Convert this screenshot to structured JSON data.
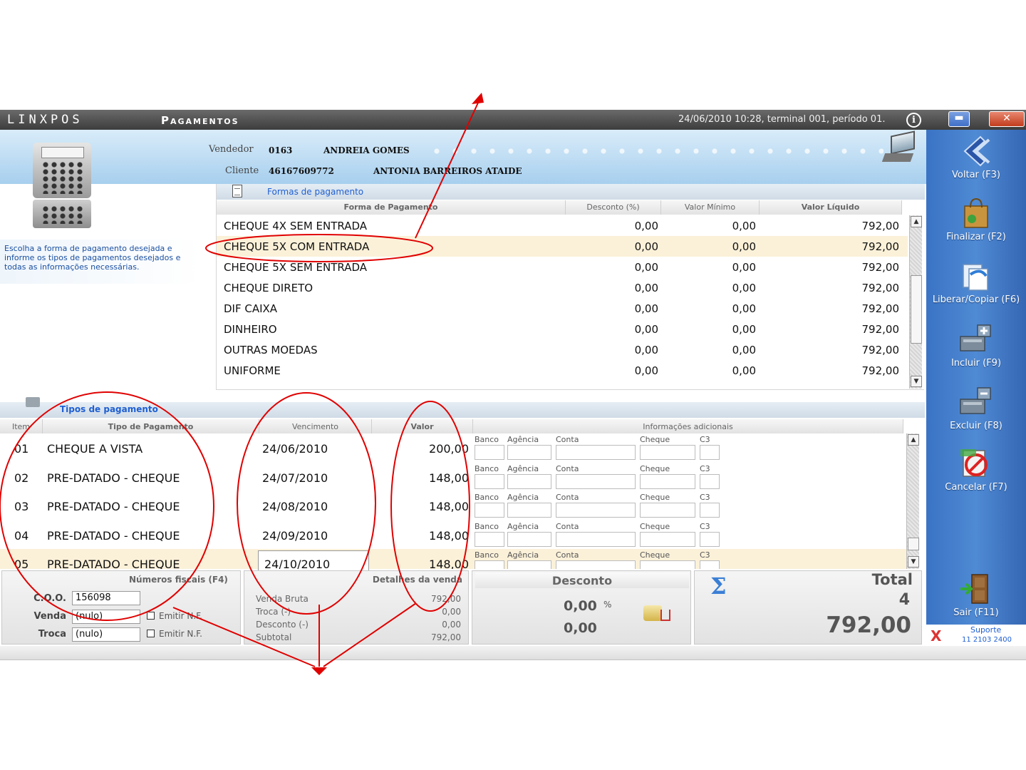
{
  "window": {
    "brand": "LINXPOS",
    "title": "Pagamentos",
    "status": "24/06/2010 10:28, terminal 001, período 01.",
    "info_glyph": "i",
    "min_glyph": "▬",
    "close_glyph": "✕"
  },
  "header": {
    "vendedor_label": "Vendedor",
    "vendedor_code": "0163",
    "vendedor_name": "ANDREIA GOMES",
    "cliente_label": "Cliente",
    "cliente_code": "46167609772",
    "cliente_name": "ANTONIA BARREIROS ATAIDE"
  },
  "help_text": "Escolha a forma de pagamento desejada e informe os tipos de pagamentos desejados e todas as informações necessárias.",
  "formas": {
    "section_label": "Formas de pagamento",
    "columns": [
      "Forma de Pagamento",
      "Desconto (%)",
      "Valor Mínimo",
      "Valor Líquido"
    ],
    "rows": [
      {
        "name": "CHEQUE 4X SEM ENTRADA",
        "desconto": "0,00",
        "minimo": "0,00",
        "liquido": "792,00"
      },
      {
        "name": "CHEQUE 5X COM ENTRADA",
        "desconto": "0,00",
        "minimo": "0,00",
        "liquido": "792,00"
      },
      {
        "name": "CHEQUE 5X SEM ENTRADA",
        "desconto": "0,00",
        "minimo": "0,00",
        "liquido": "792,00"
      },
      {
        "name": "CHEQUE DIRETO",
        "desconto": "0,00",
        "minimo": "0,00",
        "liquido": "792,00"
      },
      {
        "name": "DIF CAIXA",
        "desconto": "0,00",
        "minimo": "0,00",
        "liquido": "792,00"
      },
      {
        "name": "DINHEIRO",
        "desconto": "0,00",
        "minimo": "0,00",
        "liquido": "792,00"
      },
      {
        "name": "OUTRAS MOEDAS",
        "desconto": "0,00",
        "minimo": "0,00",
        "liquido": "792,00"
      },
      {
        "name": "UNIFORME",
        "desconto": "0,00",
        "minimo": "0,00",
        "liquido": "792,00"
      }
    ],
    "selected_index": 1
  },
  "tipos": {
    "section_label": "Tipos de pagamento",
    "columns": [
      "Item",
      "Tipo de Pagamento",
      "Vencimento",
      "Valor",
      "Informações adicionais"
    ],
    "extra_labels": [
      "Banco",
      "Agência",
      "Conta",
      "Cheque",
      "C3"
    ],
    "rows": [
      {
        "item": "01",
        "tipo": "CHEQUE A VISTA",
        "vencimento": "24/06/2010",
        "valor": "200,00"
      },
      {
        "item": "02",
        "tipo": "PRE-DATADO - CHEQUE",
        "vencimento": "24/07/2010",
        "valor": "148,00"
      },
      {
        "item": "03",
        "tipo": "PRE-DATADO - CHEQUE",
        "vencimento": "24/08/2010",
        "valor": "148,00"
      },
      {
        "item": "04",
        "tipo": "PRE-DATADO - CHEQUE",
        "vencimento": "24/09/2010",
        "valor": "148,00"
      },
      {
        "item": "05",
        "tipo": "PRE-DATADO - CHEQUE",
        "vencimento": "24/10/2010",
        "valor": "148,00"
      }
    ],
    "selected_index": 4
  },
  "fiscal": {
    "title": "Números fiscais (F4)",
    "coo_label": "C.O.O.",
    "coo_value": "156098",
    "venda_label": "Venda",
    "venda_value": "(nulo)",
    "troca_label": "Troca",
    "troca_value": "(nulo)",
    "emitir_label": "Emitir N.F."
  },
  "detalhes": {
    "title": "Detalhes da venda",
    "rows": [
      {
        "label": "Venda Bruta",
        "value": "792,00"
      },
      {
        "label": "Troca (-)",
        "value": "0,00"
      },
      {
        "label": "Desconto (-)",
        "value": "0,00"
      },
      {
        "label": "Subtotal",
        "value": "792,00"
      }
    ]
  },
  "desconto": {
    "title": "Desconto",
    "percent": "0,00",
    "percent_sign": "%",
    "value": "0,00"
  },
  "total": {
    "sigma": "Σ",
    "label": "Total",
    "qty": "4",
    "value": "792,00"
  },
  "sidebar": {
    "buttons": [
      {
        "label": "Voltar (F3)",
        "icon": "back-icon"
      },
      {
        "label": "Finalizar (F2)",
        "icon": "shopping-bag-icon"
      },
      {
        "label": "Liberar/Copiar (F6)",
        "icon": "copy-icon"
      },
      {
        "label": "Incluir (F9)",
        "icon": "add-icon"
      },
      {
        "label": "Excluir (F8)",
        "icon": "remove-icon"
      },
      {
        "label": "Cancelar (F7)",
        "icon": "cancel-icon"
      },
      {
        "label": "Sair (F11)",
        "icon": "exit-door-icon"
      }
    ],
    "support_logo": "X",
    "support_label": "Suporte",
    "support_phone": "11 2103 2400"
  },
  "colors": {
    "accent_blue": "#1f5fd1",
    "sidebar_blue": "#4f8ad4",
    "selected_row": "#fbf1d9",
    "annotation_red": "#e00000"
  }
}
